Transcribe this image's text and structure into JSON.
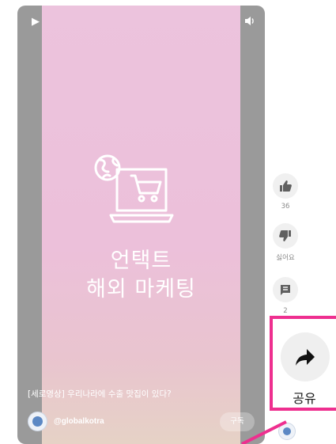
{
  "video": {
    "title_line1": "언택트",
    "title_line2": "해외 마케팅",
    "caption": "[세로영상] 우리나라에 수출 맛집이 있다?",
    "channel_handle": "@globalkotra",
    "subscribe_label": "구독"
  },
  "actions": {
    "like_count": "36",
    "dislike_label": "싫어요",
    "comment_count": "2",
    "share_label": "공유"
  },
  "icons": [
    "play-icon",
    "volume-icon",
    "globe-laptop-cart-icon",
    "thumbs-up-icon",
    "thumbs-down-icon",
    "comment-icon",
    "share-arrow-icon"
  ],
  "colors": {
    "highlight": "#ee2f8f",
    "video_background": "#ecc3dd",
    "player_background": "#9a9a9a"
  }
}
